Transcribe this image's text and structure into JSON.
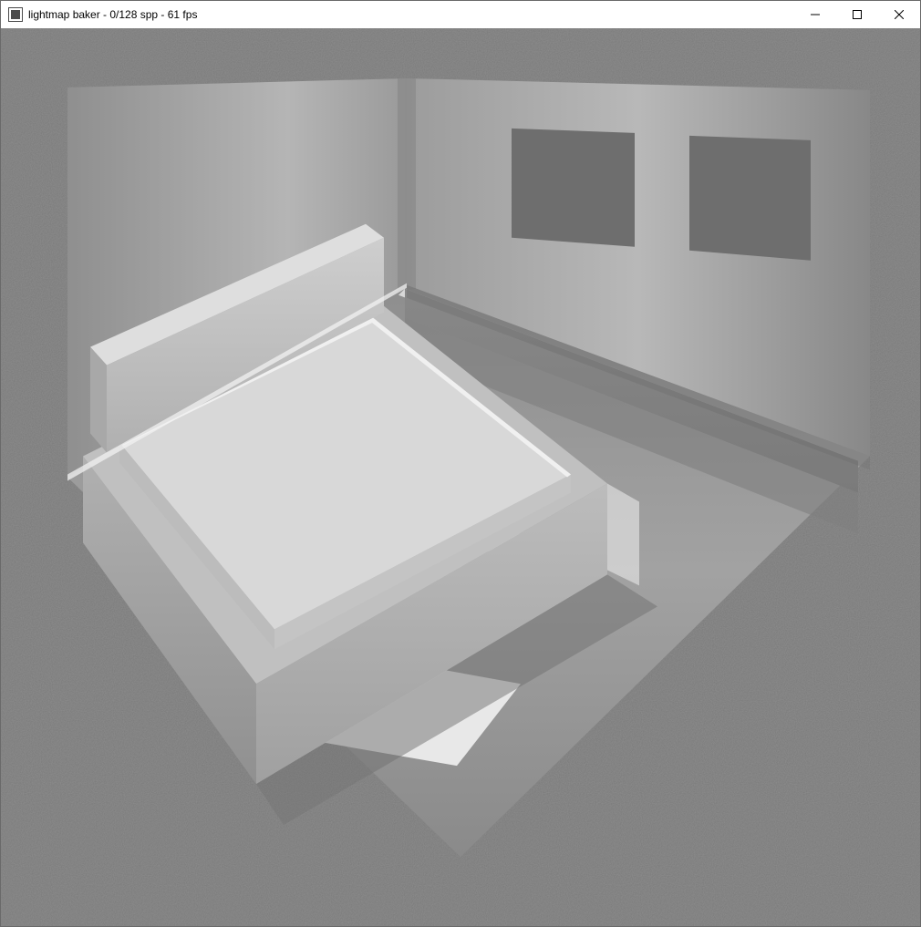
{
  "window": {
    "title": "lightmap baker - 0/128 spp - 61 fps"
  },
  "render": {
    "app_name": "lightmap baker",
    "samples_current": 0,
    "samples_total": 128,
    "fps": 61,
    "background_color": "#787878",
    "scene_description": "3D room with bed, shelf, two windows, isometric-style camera, grayscale lightmap bake preview"
  },
  "colors": {
    "titlebar_bg": "#ffffff",
    "titlebar_text": "#000000",
    "viewport_bg": "#787878"
  }
}
